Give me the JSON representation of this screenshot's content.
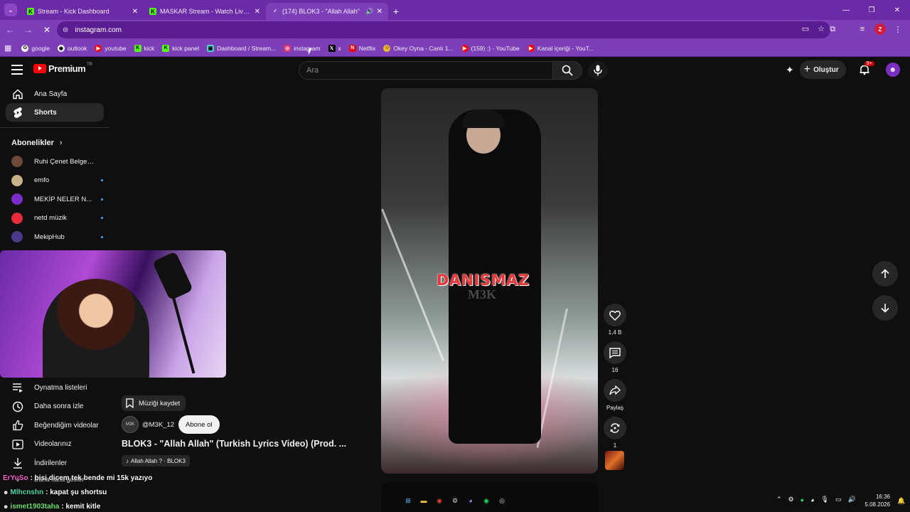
{
  "browser": {
    "tabs": [
      {
        "title": "Stream - Kick Dashboard",
        "icon": "kick-icon"
      },
      {
        "title": "MASKAR Stream - Watch Live o",
        "icon": "kick-icon"
      },
      {
        "title": "(174) BLOK3 - \"Allah Allah\"",
        "icon": "loading-icon",
        "active": true
      }
    ],
    "new_tab": "+",
    "url": "instagram.com",
    "profile_letter": "Z",
    "bookmarks": [
      {
        "label": "google",
        "color": "#ffffff"
      },
      {
        "label": "outlook",
        "color": "#ffffff"
      },
      {
        "label": "youtube",
        "color": "#ff0000"
      },
      {
        "label": "kick",
        "color": "#53fc18"
      },
      {
        "label": "kick panel",
        "color": "#53fc18"
      },
      {
        "label": "Dashboard / Stream...",
        "color": "#4dd0c8"
      },
      {
        "label": "instagram",
        "color": "#e1306c"
      },
      {
        "label": "x",
        "color": "#000000"
      },
      {
        "label": "Netflix",
        "color": "#e50914"
      },
      {
        "label": "Okey Oyna - Canlı 1...",
        "color": "#f2b62c"
      },
      {
        "label": "(159) :) - YouTube",
        "color": "#ff0000"
      },
      {
        "label": "Kanal içeriği - YouT...",
        "color": "#ff0000"
      }
    ]
  },
  "youtube": {
    "logo_text": "Premium",
    "logo_region": "TR",
    "search_placeholder": "Ara",
    "create_label": "Oluştur",
    "notif_badge": "9+",
    "nav": [
      {
        "label": "Ana Sayfa",
        "icon": "home-icon"
      },
      {
        "label": "Shorts",
        "icon": "shorts-icon",
        "active": true
      }
    ],
    "subscriptions_heading": "Abonelikler",
    "subscriptions": [
      {
        "name": "Ruhi Çenet Belgese...",
        "color": "#6b4a3a",
        "dot": false
      },
      {
        "name": "emfo",
        "color": "#c9b18a",
        "dot": true
      },
      {
        "name": "MEKİP NELER N...",
        "color": "#7a2cc7",
        "dot": true
      },
      {
        "name": "netd müzik",
        "color": "#e62c3a",
        "dot": true
      },
      {
        "name": "MekipHub",
        "color": "#4b3a8a",
        "dot": true
      }
    ],
    "you_items": [
      {
        "label": "Oynatma listeleri",
        "icon": "playlist-icon"
      },
      {
        "label": "Daha sonra izle",
        "icon": "clock-icon"
      },
      {
        "label": "Beğendiğim videolar",
        "icon": "thumbs-up-icon"
      },
      {
        "label": "Videolarınız",
        "icon": "video-icon"
      },
      {
        "label": "İndirilenler",
        "icon": "download-icon"
      },
      {
        "label": "Daha fazla göster",
        "icon": "chevron-down-icon"
      }
    ],
    "short": {
      "save_music": "Müziği kaydet",
      "channel": "@M3K_12",
      "channel_avatar_text": "M3K",
      "subscribe": "Abone ol",
      "title": "BLOK3 - \"Allah Allah\" (Turkish Lyrics Video) (Prod. ...",
      "music_tag": "Allah Allah ? · BLOK3",
      "overlay_title": "DANISMAZ",
      "overlay_sub": "M3K",
      "likes": "1,4 B",
      "comments": "16",
      "share": "Paylaş",
      "remix": "1"
    }
  },
  "chat": [
    {
      "user": "ErYuSo",
      "msg": ": bisi dicem tek bende mi 15k yazıyo"
    },
    {
      "user": "Mlhcnshn",
      "msg": ": kapat şu shortsu"
    },
    {
      "user": "ismet1903taha",
      "msg": ": kemit kitle"
    }
  ],
  "taskbar": {
    "time": "16:36",
    "date": "5.08.2026"
  }
}
